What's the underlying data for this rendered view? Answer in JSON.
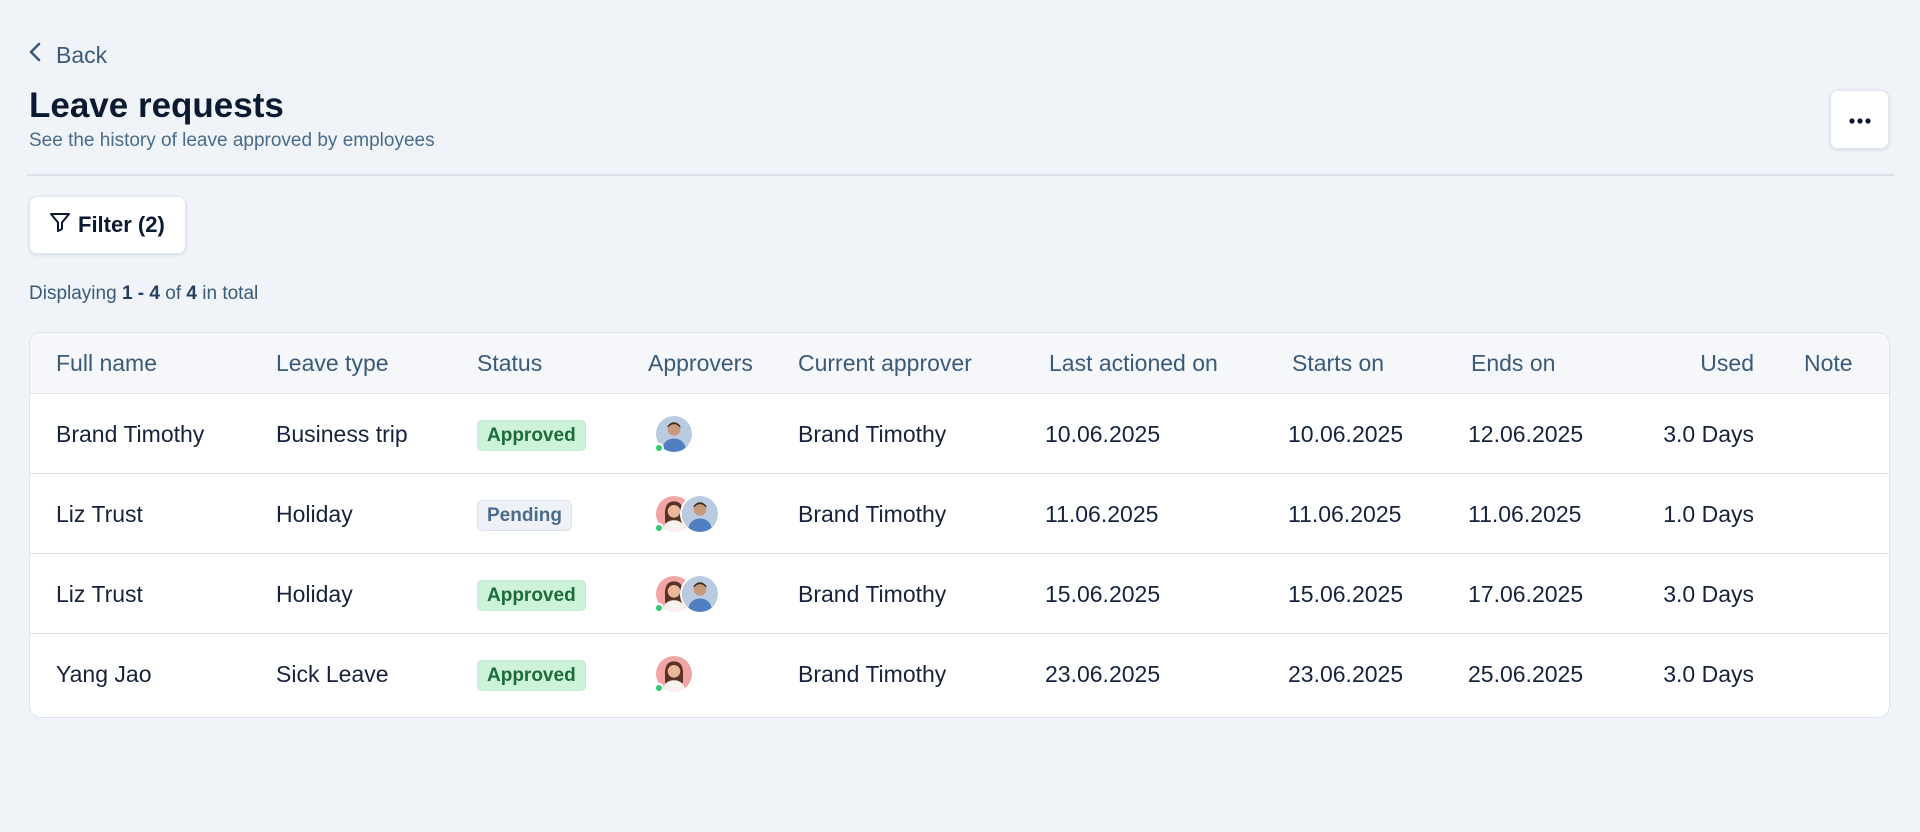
{
  "back": {
    "label": "Back"
  },
  "page": {
    "title": "Leave requests",
    "subtitle": "See the history of leave approved by employees"
  },
  "filter": {
    "label": "Filter (2)"
  },
  "summary": {
    "prefix": "Displaying",
    "range": "1 - 4",
    "of": "of",
    "total": "4",
    "suffix": "in total"
  },
  "table": {
    "headers": {
      "full_name": "Full name",
      "leave_type": "Leave type",
      "status": "Status",
      "approvers": "Approvers",
      "current_approver": "Current approver",
      "last_actioned_on": "Last actioned on",
      "starts_on": "Starts on",
      "ends_on": "Ends on",
      "used": "Used",
      "note": "Note"
    },
    "rows": [
      {
        "full_name": "Brand Timothy",
        "leave_type": "Business trip",
        "status": "Approved",
        "approvers": [
          "man-avatar"
        ],
        "current_approver": "Brand Timothy",
        "last_actioned_on": "10.06.2025",
        "starts_on": "10.06.2025",
        "ends_on": "12.06.2025",
        "used": "3.0 Days",
        "note": ""
      },
      {
        "full_name": "Liz Trust",
        "leave_type": "Holiday",
        "status": "Pending",
        "approvers": [
          "woman-avatar",
          "man-avatar"
        ],
        "current_approver": "Brand Timothy",
        "last_actioned_on": "11.06.2025",
        "starts_on": "11.06.2025",
        "ends_on": "11.06.2025",
        "used": "1.0 Days",
        "note": ""
      },
      {
        "full_name": "Liz Trust",
        "leave_type": "Holiday",
        "status": "Approved",
        "approvers": [
          "woman-avatar",
          "man-avatar"
        ],
        "current_approver": "Brand Timothy",
        "last_actioned_on": "15.06.2025",
        "starts_on": "15.06.2025",
        "ends_on": "17.06.2025",
        "used": "3.0 Days",
        "note": ""
      },
      {
        "full_name": "Yang Jao",
        "leave_type": "Sick Leave",
        "status": "Approved",
        "approvers": [
          "woman-avatar"
        ],
        "current_approver": "Brand Timothy",
        "last_actioned_on": "23.06.2025",
        "starts_on": "23.06.2025",
        "ends_on": "25.06.2025",
        "used": "3.0 Days",
        "note": ""
      }
    ]
  },
  "colors": {
    "background": "#f0f3f7",
    "approved_bg": "#ccf3da",
    "approved_text": "#1b6b3b",
    "pending_bg": "#eef2f7",
    "pending_text": "#4a6b8c",
    "online_dot": "#2ecc71"
  },
  "icons": {
    "back": "chevron-left-icon",
    "more": "more-horizontal-icon",
    "filter": "filter-funnel-icon"
  }
}
